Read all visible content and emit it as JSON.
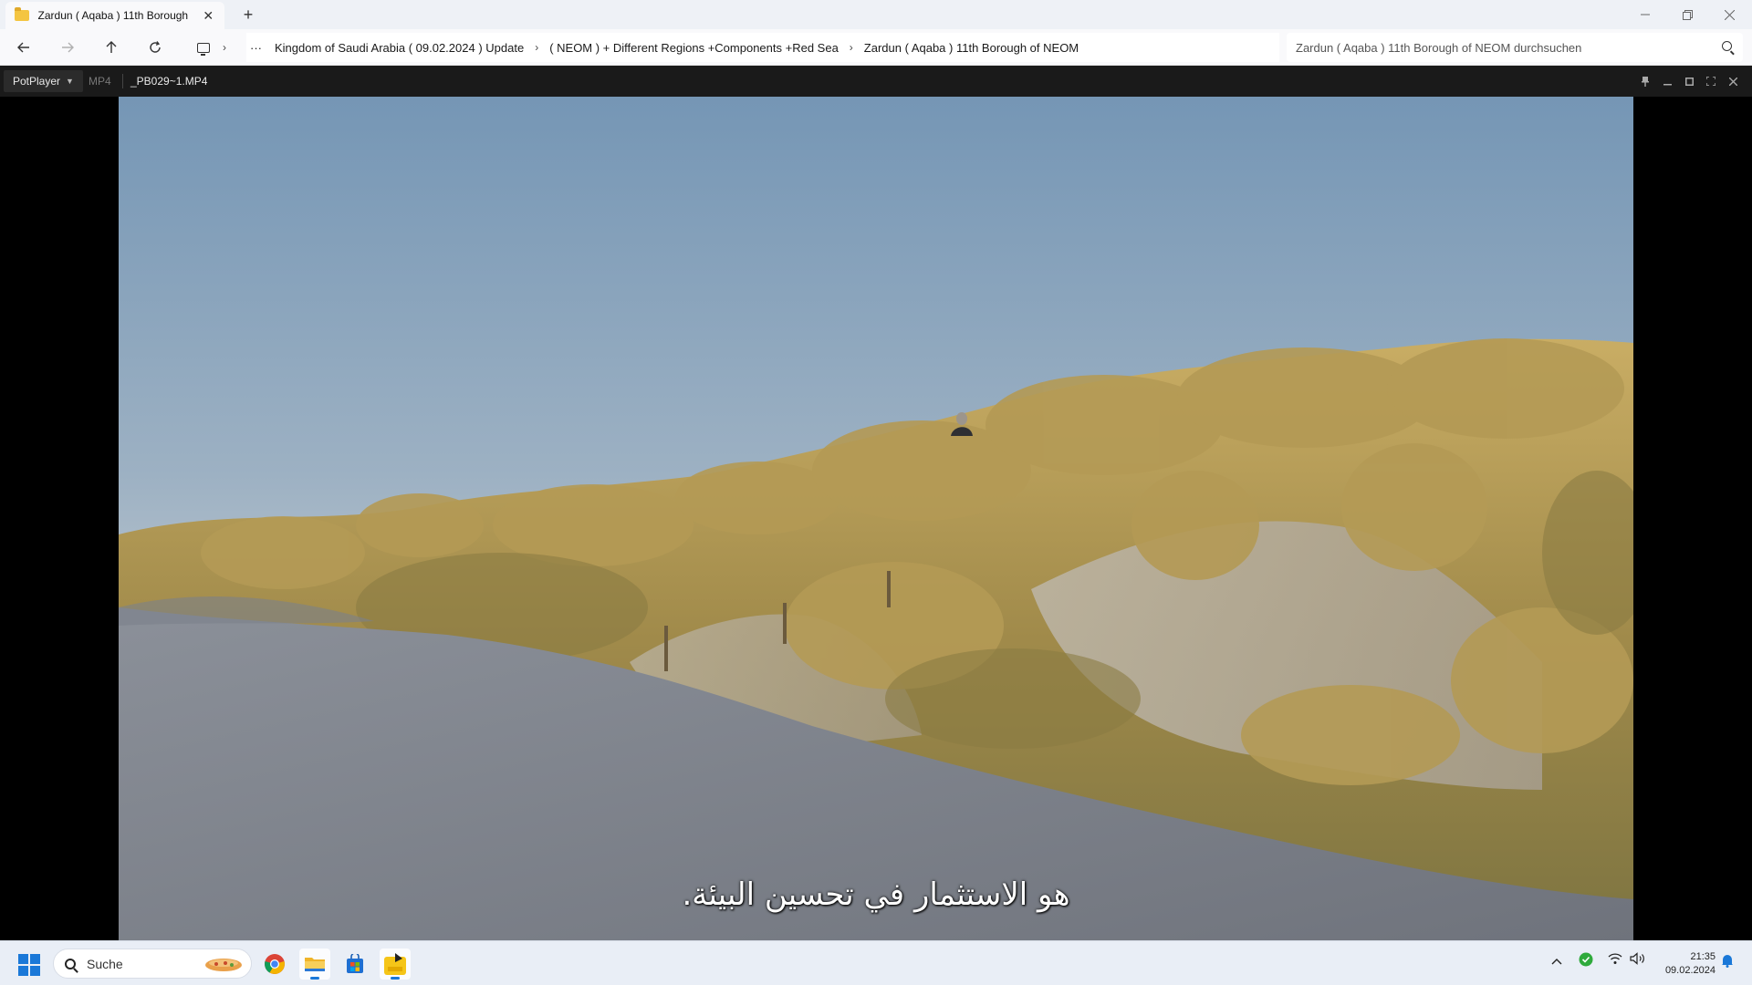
{
  "explorer": {
    "tab_title": "Zardun ( Aqaba )  11th Borough of NEOM",
    "tab_close": "✕",
    "new_tab": "+",
    "breadcrumbs": [
      "Kingdom of Saudi Arabia ( 09.02.2024 ) Update",
      "( NEOM ) + Different Regions +Components +Red Sea",
      "Zardun ( Aqaba )  11th Borough of NEOM"
    ],
    "overflow": "···",
    "search_placeholder": "Zardun ( Aqaba )  11th Borough of NEOM durchsuchen"
  },
  "player": {
    "brand": "PotPlayer",
    "format": "MP4",
    "filename": "_PB029~1.MP4",
    "subtitle": "هو الاستثمار في تحسين البيئة."
  },
  "taskbar": {
    "search_label": "Suche",
    "time": "21:35",
    "date": "09.02.2024"
  },
  "colors": {
    "accent": "#1a78d8",
    "sky_top": "#7a9bb8",
    "sky_bottom": "#c4ccd2",
    "grass": "#a8904f",
    "sand": "#9a9ea7"
  }
}
